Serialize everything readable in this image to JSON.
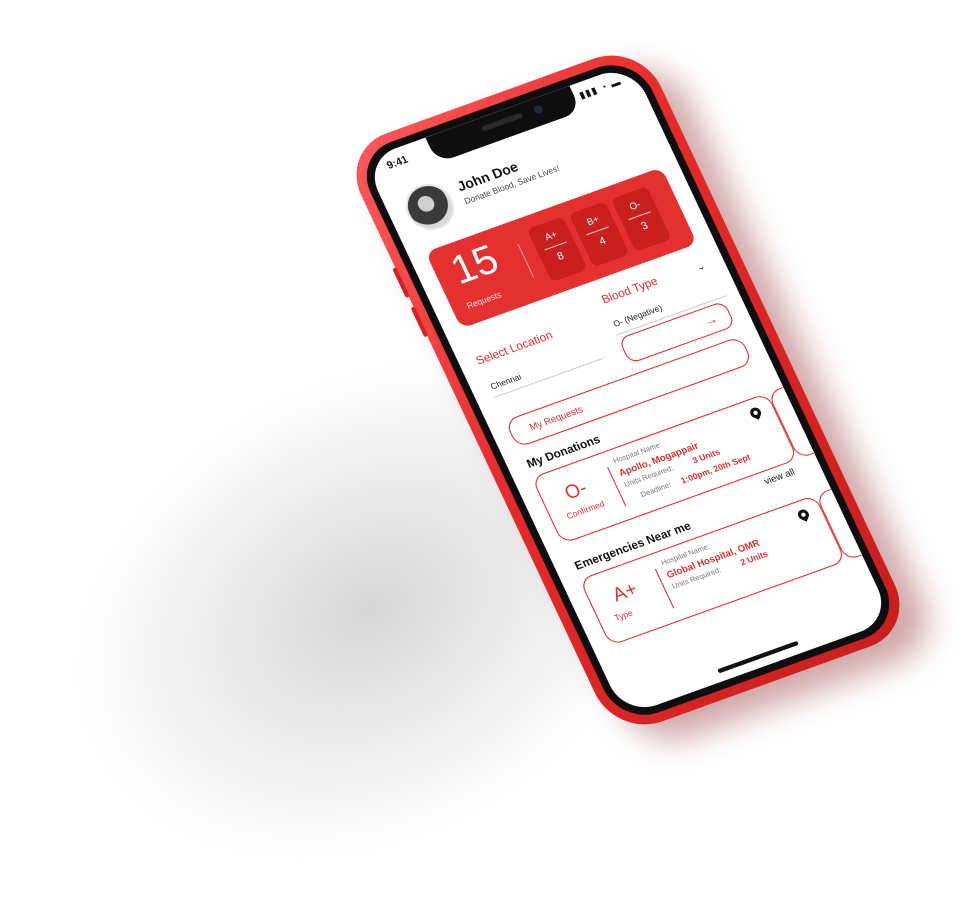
{
  "status_bar": {
    "time": "9:41",
    "icons": "▮▮▮ ◔ ▬"
  },
  "user": {
    "name": "John Doe",
    "tagline": "Donate Blood, Save Lives!"
  },
  "stats": {
    "count": "15",
    "count_label": "Requests",
    "types": [
      {
        "type": "A+",
        "value": "8"
      },
      {
        "type": "B+",
        "value": "4"
      },
      {
        "type": "O-",
        "value": "3"
      }
    ]
  },
  "filters": {
    "location_label": "Select Location",
    "location_value": "Chennai",
    "blood_type_label": "Blood Type",
    "blood_type_value": "O- (Negative)"
  },
  "go_button": {
    "arrow": "→"
  },
  "my_requests_label": "My Requests",
  "donations": {
    "title": "My Donations",
    "card": {
      "type": "O-",
      "status": "Confirmed",
      "hospital_label": "Hospital Name:",
      "hospital": "Apollo, Mogappair",
      "units_label": "Units Required:",
      "units": "3 Units",
      "deadline_label": "Deadline:",
      "deadline": "1:00pm, 20th Sept"
    }
  },
  "emergencies": {
    "title": "Emergencies Near me",
    "view_all": "view all",
    "card": {
      "type": "A+",
      "status": "Type",
      "hospital_label": "Hospital Name:",
      "hospital": "Global Hospital, OMR",
      "units_label": "Units Required:",
      "units": "2 Units"
    }
  },
  "colors": {
    "accent": "#e4302f",
    "frame": "#e52b2b"
  }
}
